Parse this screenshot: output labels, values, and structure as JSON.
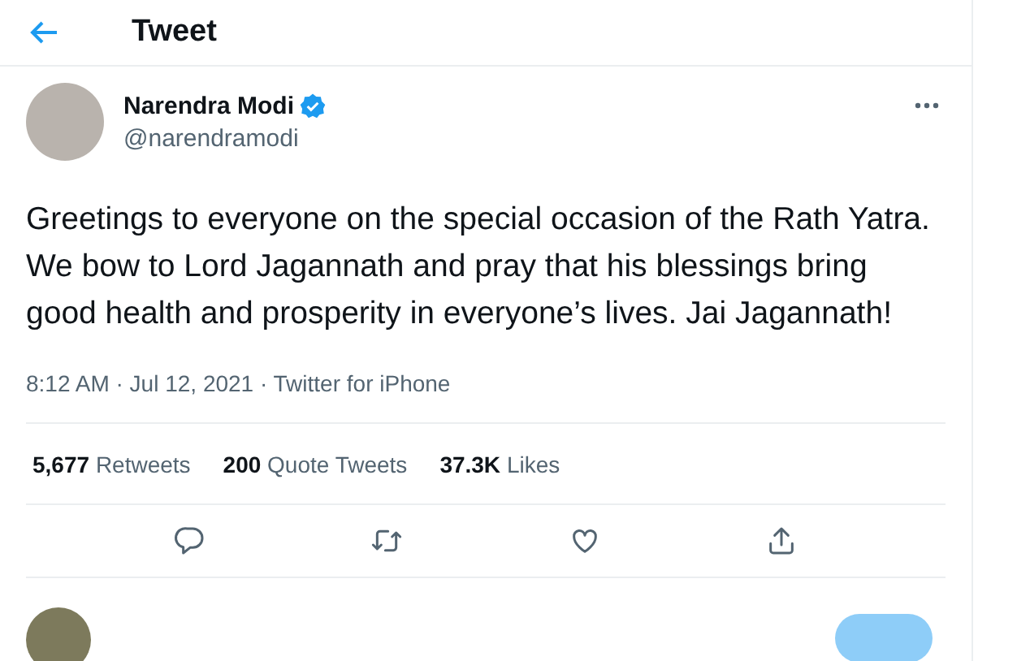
{
  "header": {
    "title": "Tweet"
  },
  "tweet": {
    "author": {
      "name": "Narendra Modi",
      "handle": "@narendramodi",
      "verified": true
    },
    "text": "Greetings to everyone on the special occasion of the Rath Yatra. We bow to Lord Jagannath and pray that his blessings bring good health and prosperity in everyone’s lives. Jai Jagannath!",
    "meta": "8:12 AM · Jul 12, 2021 · Twitter for iPhone",
    "stats": [
      {
        "count": "5,677",
        "label": "Retweets"
      },
      {
        "count": "200",
        "label": "Quote Tweets"
      },
      {
        "count": "37.3K",
        "label": "Likes"
      }
    ],
    "actions": [
      {
        "kind": "reply"
      },
      {
        "kind": "retweet"
      },
      {
        "kind": "like"
      },
      {
        "kind": "share"
      }
    ]
  }
}
